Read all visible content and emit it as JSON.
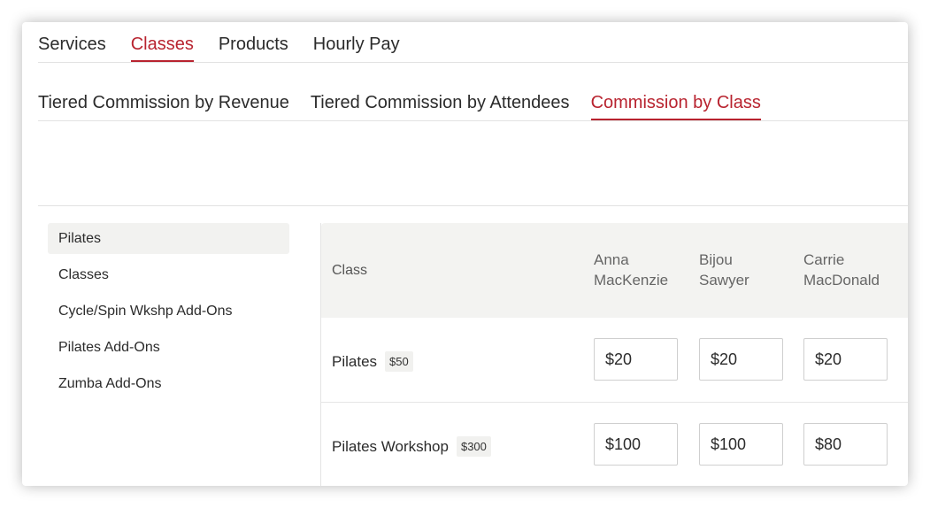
{
  "primary_tabs": [
    {
      "label": "Services",
      "active": false
    },
    {
      "label": "Classes",
      "active": true
    },
    {
      "label": "Products",
      "active": false
    },
    {
      "label": "Hourly Pay",
      "active": false
    }
  ],
  "secondary_tabs": [
    {
      "label": "Tiered Commission by Revenue",
      "active": false
    },
    {
      "label": "Tiered Commission by Attendees",
      "active": false
    },
    {
      "label": "Commission by Class",
      "active": true
    }
  ],
  "sidebar": {
    "items": [
      {
        "label": "Pilates",
        "active": true
      },
      {
        "label": "Classes",
        "active": false
      },
      {
        "label": "Cycle/Spin Wkshp Add-Ons",
        "active": false
      },
      {
        "label": "Pilates Add-Ons",
        "active": false
      },
      {
        "label": "Zumba Add-Ons",
        "active": false
      }
    ]
  },
  "table": {
    "class_header": "Class",
    "staff": [
      {
        "first": "Anna",
        "last": "MacKenzie"
      },
      {
        "first": "Bijou",
        "last": "Sawyer"
      },
      {
        "first": "Carrie",
        "last": "MacDonald"
      }
    ],
    "rows": [
      {
        "name": "Pilates",
        "price": "$50",
        "rates": [
          "$20",
          "$20",
          "$20"
        ]
      },
      {
        "name": "Pilates Workshop",
        "price": "$300",
        "rates": [
          "$100",
          "$100",
          "$80"
        ]
      }
    ]
  },
  "colors": {
    "accent": "#b8232f",
    "header_bg": "#f3f3f1",
    "sidebar_active_bg": "#f2f2f0"
  }
}
